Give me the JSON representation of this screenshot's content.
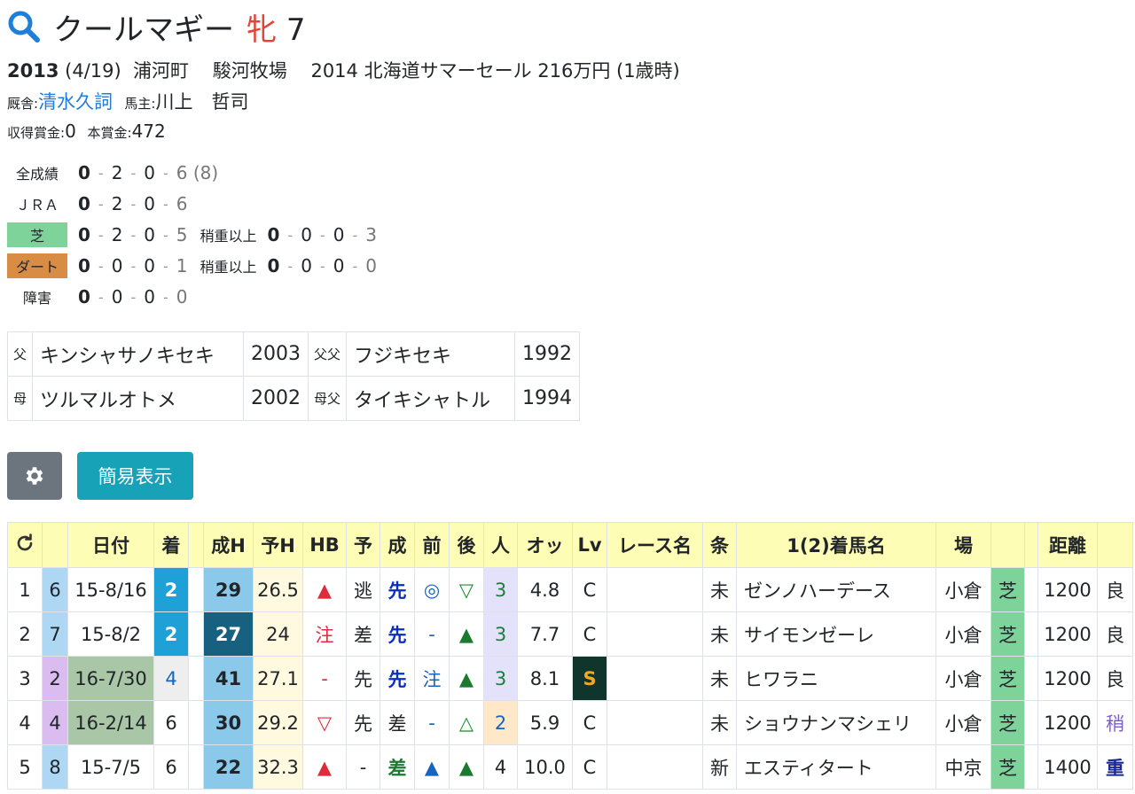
{
  "horse": {
    "name": "クールマギー",
    "sex": "牝",
    "age": "7",
    "birth_year": "2013",
    "birth_date": "(4/19)",
    "region": "浦河町",
    "breeder": "駿河牧場",
    "sale": "2014 北海道サマーセール 216万円 (1歳時)",
    "trainer_label": "厩舎:",
    "trainer": "清水久詞",
    "owner_label": "馬主:",
    "owner": "川上　哲司",
    "earn_label": "収得賞金:",
    "earn": "0",
    "prize_label": "本賞金:",
    "prize": "472"
  },
  "records": {
    "all": {
      "label": "全成績",
      "a": "0",
      "b": "2",
      "c": "0",
      "d": "6",
      "extra": "(8)"
    },
    "jra": {
      "label": "ＪＲＡ",
      "a": "0",
      "b": "2",
      "c": "0",
      "d": "6"
    },
    "turf": {
      "label": "芝",
      "a": "0",
      "b": "2",
      "c": "0",
      "d": "5",
      "sub_label": "稍重以上",
      "sa": "0",
      "sb": "0",
      "sc": "0",
      "sd": "3"
    },
    "dirt": {
      "label": "ダート",
      "a": "0",
      "b": "0",
      "c": "0",
      "d": "1",
      "sub_label": "稍重以上",
      "sa": "0",
      "sb": "0",
      "sc": "0",
      "sd": "0"
    },
    "jump": {
      "label": "障害",
      "a": "0",
      "b": "0",
      "c": "0",
      "d": "0"
    },
    "sep": "-"
  },
  "pedigree": {
    "sire_label": "父",
    "sire": "キンシャサノキセキ",
    "sire_year": "2003",
    "sire_sire_label": "父父",
    "sire_sire": "フジキセキ",
    "sire_sire_year": "1992",
    "dam_label": "母",
    "dam": "ツルマルオトメ",
    "dam_year": "2002",
    "dam_sire_label": "母父",
    "dam_sire": "タイキシャトル",
    "dam_sire_year": "1994"
  },
  "buttons": {
    "gear_icon": "gear-icon",
    "simple": "簡易表示"
  },
  "table": {
    "refresh_icon": "refresh-icon",
    "headers": [
      "",
      "",
      "日付",
      "着",
      "",
      "成H",
      "予H",
      "HB",
      "予",
      "成",
      "前",
      "後",
      "人",
      "オッ",
      "Lv",
      "レース名",
      "条",
      "1(2)着馬名",
      "場",
      "",
      "",
      "距離",
      ""
    ],
    "rows": [
      {
        "no": "1",
        "w": "6",
        "date": "15-8/16",
        "rank": "2",
        "sh": "29",
        "yh": "26.5",
        "hb": "▲",
        "yo": "逃",
        "sei": "先",
        "mae": "◎",
        "ato": "▽",
        "pop": "3",
        "odds": "4.8",
        "lv": "C",
        "race": "",
        "cond": "未",
        "winner": "ゼンノハーデース",
        "course": "小倉",
        "surface": "芝",
        "dist": "1200",
        "going": "良"
      },
      {
        "no": "2",
        "w": "7",
        "date": "15-8/2",
        "rank": "2",
        "sh": "27",
        "yh": "24",
        "hb": "注",
        "yo": "差",
        "sei": "先",
        "mae": "-",
        "ato": "▲",
        "pop": "3",
        "odds": "7.7",
        "lv": "C",
        "race": "",
        "cond": "未",
        "winner": "サイモンゼーレ",
        "course": "小倉",
        "surface": "芝",
        "dist": "1200",
        "going": "良"
      },
      {
        "no": "3",
        "w": "2",
        "date": "16-7/30",
        "rank": "4",
        "sh": "41",
        "yh": "27.1",
        "hb": "-",
        "yo": "先",
        "sei": "先",
        "mae": "注",
        "ato": "▲",
        "pop": "3",
        "odds": "8.1",
        "lv": "S",
        "race": "",
        "cond": "未",
        "winner": "ヒワラニ",
        "course": "小倉",
        "surface": "芝",
        "dist": "1200",
        "going": "良"
      },
      {
        "no": "4",
        "w": "4",
        "date": "16-2/14",
        "rank": "6",
        "sh": "30",
        "yh": "29.2",
        "hb": "▽",
        "yo": "先",
        "sei": "差",
        "mae": "-",
        "ato": "△",
        "pop": "2",
        "odds": "5.9",
        "lv": "C",
        "race": "",
        "cond": "未",
        "winner": "ショウナンマシェリ",
        "course": "小倉",
        "surface": "芝",
        "dist": "1200",
        "going": "稍"
      },
      {
        "no": "5",
        "w": "8",
        "date": "15-7/5",
        "rank": "6",
        "sh": "22",
        "yh": "32.3",
        "hb": "▲",
        "yo": "-",
        "sei": "差",
        "mae": "▲",
        "ato": "▲",
        "pop": "4",
        "odds": "10.0",
        "lv": "C",
        "race": "",
        "cond": "新",
        "winner": "エスティタート",
        "course": "中京",
        "surface": "芝",
        "dist": "1400",
        "going": "重"
      }
    ]
  },
  "colors": {
    "accent": "#17a2b8",
    "header_bg": "#fdfdb5",
    "female": "#e0453a",
    "link": "#1f7ed8"
  }
}
